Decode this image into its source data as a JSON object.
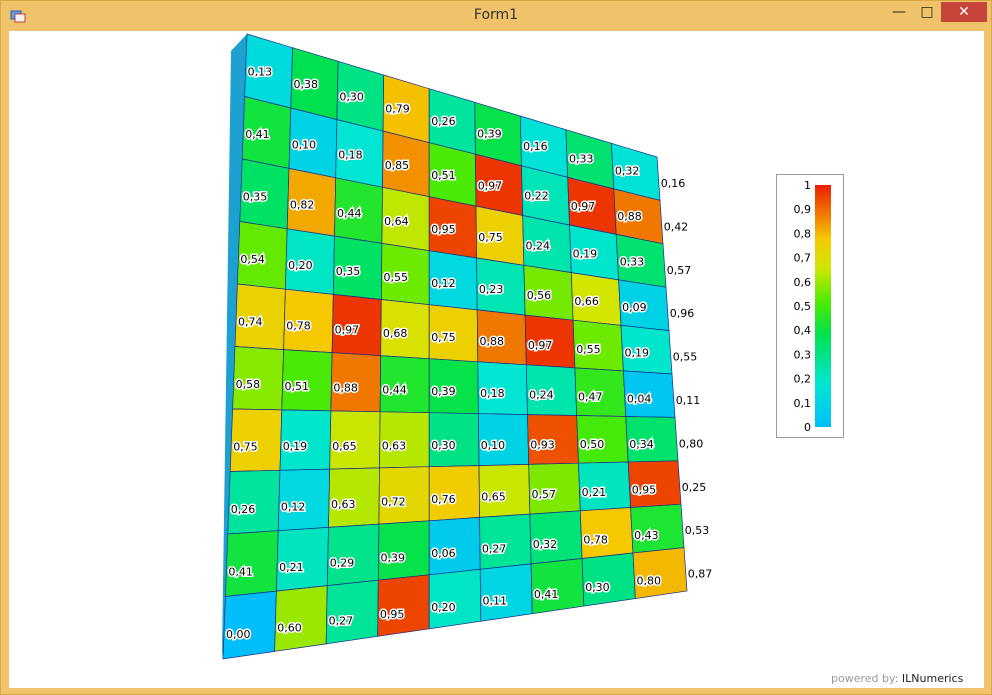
{
  "window": {
    "title": "Form1",
    "minimize_glyph": "—",
    "maximize_glyph": "□",
    "close_glyph": "✕",
    "app_icon": "form-app-icon"
  },
  "chart_data": {
    "type": "heatmap",
    "rows": 11,
    "cols": 9,
    "colormap": "cyan-green-yellow-red",
    "color_range": [
      0,
      1
    ],
    "labels": [
      [
        "0,13",
        "0,38",
        "0,30",
        "0,79",
        "0,26",
        "0,39",
        "0,16",
        "0,33",
        "0,32",
        "0,16"
      ],
      [
        "0,41",
        "0,10",
        "0,18",
        "0,85",
        "0,51",
        "0,97",
        "0,22",
        "0,97",
        "0,88",
        "0,42"
      ],
      [
        "0,35",
        "0,82",
        "0,44",
        "0,64",
        "0,95",
        "0,75",
        "0,24",
        "0,19",
        "0,33",
        "0,57"
      ],
      [
        "0,54",
        "0,20",
        "0,35",
        "0,55",
        "0,12",
        "0,23",
        "0,56",
        "0,66",
        "0,09",
        "0,96"
      ],
      [
        "0,74",
        "0,78",
        "0,97",
        "0,68",
        "0,75",
        "0,88",
        "0,97",
        "0,55",
        "0,19",
        "0,55"
      ],
      [
        "0,58",
        "0,51",
        "0,88",
        "0,44",
        "0,39",
        "0,18",
        "0,24",
        "0,47",
        "0,04",
        "0,11"
      ],
      [
        "0,75",
        "0,19",
        "0,65",
        "0,63",
        "0,30",
        "0,10",
        "0,93",
        "0,50",
        "0,34",
        "0,80"
      ],
      [
        "0,26",
        "0,12",
        "0,63",
        "0,72",
        "0,76",
        "0,65",
        "0,57",
        "0,21",
        "0,95",
        "0,25"
      ],
      [
        "0,41",
        "0,21",
        "0,29",
        "0,39",
        "0,06",
        "0,27",
        "0,32",
        "0,78",
        "0,43",
        "0,53"
      ],
      [
        "0,00",
        "0,60",
        "0,27",
        "0,95",
        "0,20",
        "0,11",
        "0,41",
        "0,30",
        "0,80",
        "0,87"
      ]
    ],
    "cell_values": [
      [
        0.13,
        0.38,
        0.3,
        0.79,
        0.26,
        0.39,
        0.16,
        0.33,
        0.16
      ],
      [
        0.41,
        0.1,
        0.18,
        0.85,
        0.51,
        0.97,
        0.22,
        0.97,
        0.88
      ],
      [
        0.35,
        0.82,
        0.44,
        0.64,
        0.95,
        0.75,
        0.24,
        0.19,
        0.33
      ],
      [
        0.54,
        0.2,
        0.35,
        0.55,
        0.12,
        0.23,
        0.56,
        0.66,
        0.09
      ],
      [
        0.74,
        0.78,
        0.97,
        0.68,
        0.75,
        0.88,
        0.97,
        0.55,
        0.19
      ],
      [
        0.58,
        0.51,
        0.88,
        0.44,
        0.39,
        0.18,
        0.24,
        0.47,
        0.04
      ],
      [
        0.75,
        0.19,
        0.65,
        0.63,
        0.3,
        0.1,
        0.93,
        0.5,
        0.34
      ],
      [
        0.26,
        0.12,
        0.63,
        0.72,
        0.76,
        0.65,
        0.57,
        0.21,
        0.95
      ],
      [
        0.41,
        0.21,
        0.29,
        0.39,
        0.06,
        0.27,
        0.32,
        0.78,
        0.43
      ],
      [
        0.0,
        0.6,
        0.27,
        0.95,
        0.2,
        0.11,
        0.41,
        0.3,
        0.8
      ]
    ],
    "colorbar": {
      "ticks": [
        "1",
        "0,9",
        "0,8",
        "0,7",
        "0,6",
        "0,5",
        "0,4",
        "0,3",
        "0,2",
        "0,1",
        "0"
      ],
      "colors": [
        "#00bfff",
        "#00e0c0",
        "#00e060",
        "#20ee00",
        "#a0e000",
        "#f0e000",
        "#f0a000",
        "#f05000",
        "#ee1100"
      ]
    }
  },
  "footer": {
    "powered_by": "powered by:",
    "brand": "ILNumerics"
  }
}
